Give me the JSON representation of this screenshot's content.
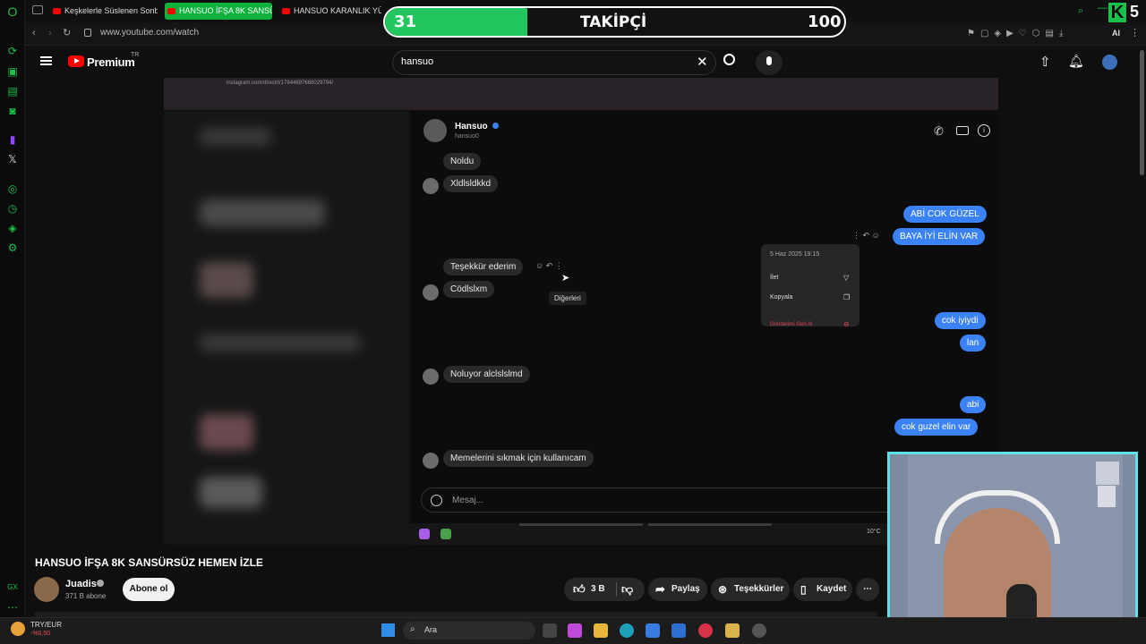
{
  "browser": {
    "tabs": [
      {
        "label": "Keşkelerle Süslenen Sonb"
      },
      {
        "label": "HANSUO İFŞA 8K SANSÜ"
      },
      {
        "label": "HANSUO KARANLIK YÜZ"
      }
    ],
    "url": "www.youtube.com/watch",
    "toolbar_ai": "AI"
  },
  "youtube": {
    "logo_text": "Premium",
    "logo_sup": "TR",
    "search_value": "hansuo"
  },
  "video": {
    "instagram_url": "instagram.com/direct/t/17844697668029794/",
    "chat": {
      "user_name": "Hansuo",
      "user_handle": "hansuo0",
      "messages_left": [
        "Noldu",
        "Xldlsldkkd",
        "Teşekkür ederim",
        "Cödlslxm",
        "Noluyor alclslslmd",
        "Memelerini sıkmak için kullanıcam"
      ],
      "messages_right": [
        "ABİ COK GÜZEL",
        "BAYA İYİ ELİN VAR",
        "cok iyiydi",
        "lan",
        "abi",
        "cok guzel elin var"
      ],
      "tooltip": "Diğerleri",
      "context_menu": {
        "date": "5 Haz 2025 19:15",
        "items": [
          "İlet",
          "Kopyala",
          "Gönderimi Geri Al"
        ]
      },
      "composer_placeholder": "Mesaj...",
      "weather": "10°C"
    }
  },
  "overlay": {
    "follow_current": "31",
    "follow_label": "TAKİPÇİ",
    "follow_goal": "100",
    "follow_progress": 0.31,
    "logo_letter": "K",
    "logo_num": "5"
  },
  "below": {
    "title": "HANSUO İFŞA 8K SANSÜRSÜZ HEMEN İZLE",
    "channel": "Juadis",
    "subs": "371 B abone",
    "subscribe": "Abone ol",
    "likes": "3 B",
    "share": "Paylaş",
    "thanks": "Teşekkürler",
    "save": "Kaydet"
  },
  "taskbar": {
    "ticker": "TRY/EUR",
    "ticker_change": "-%0,50",
    "search": "Ara"
  }
}
